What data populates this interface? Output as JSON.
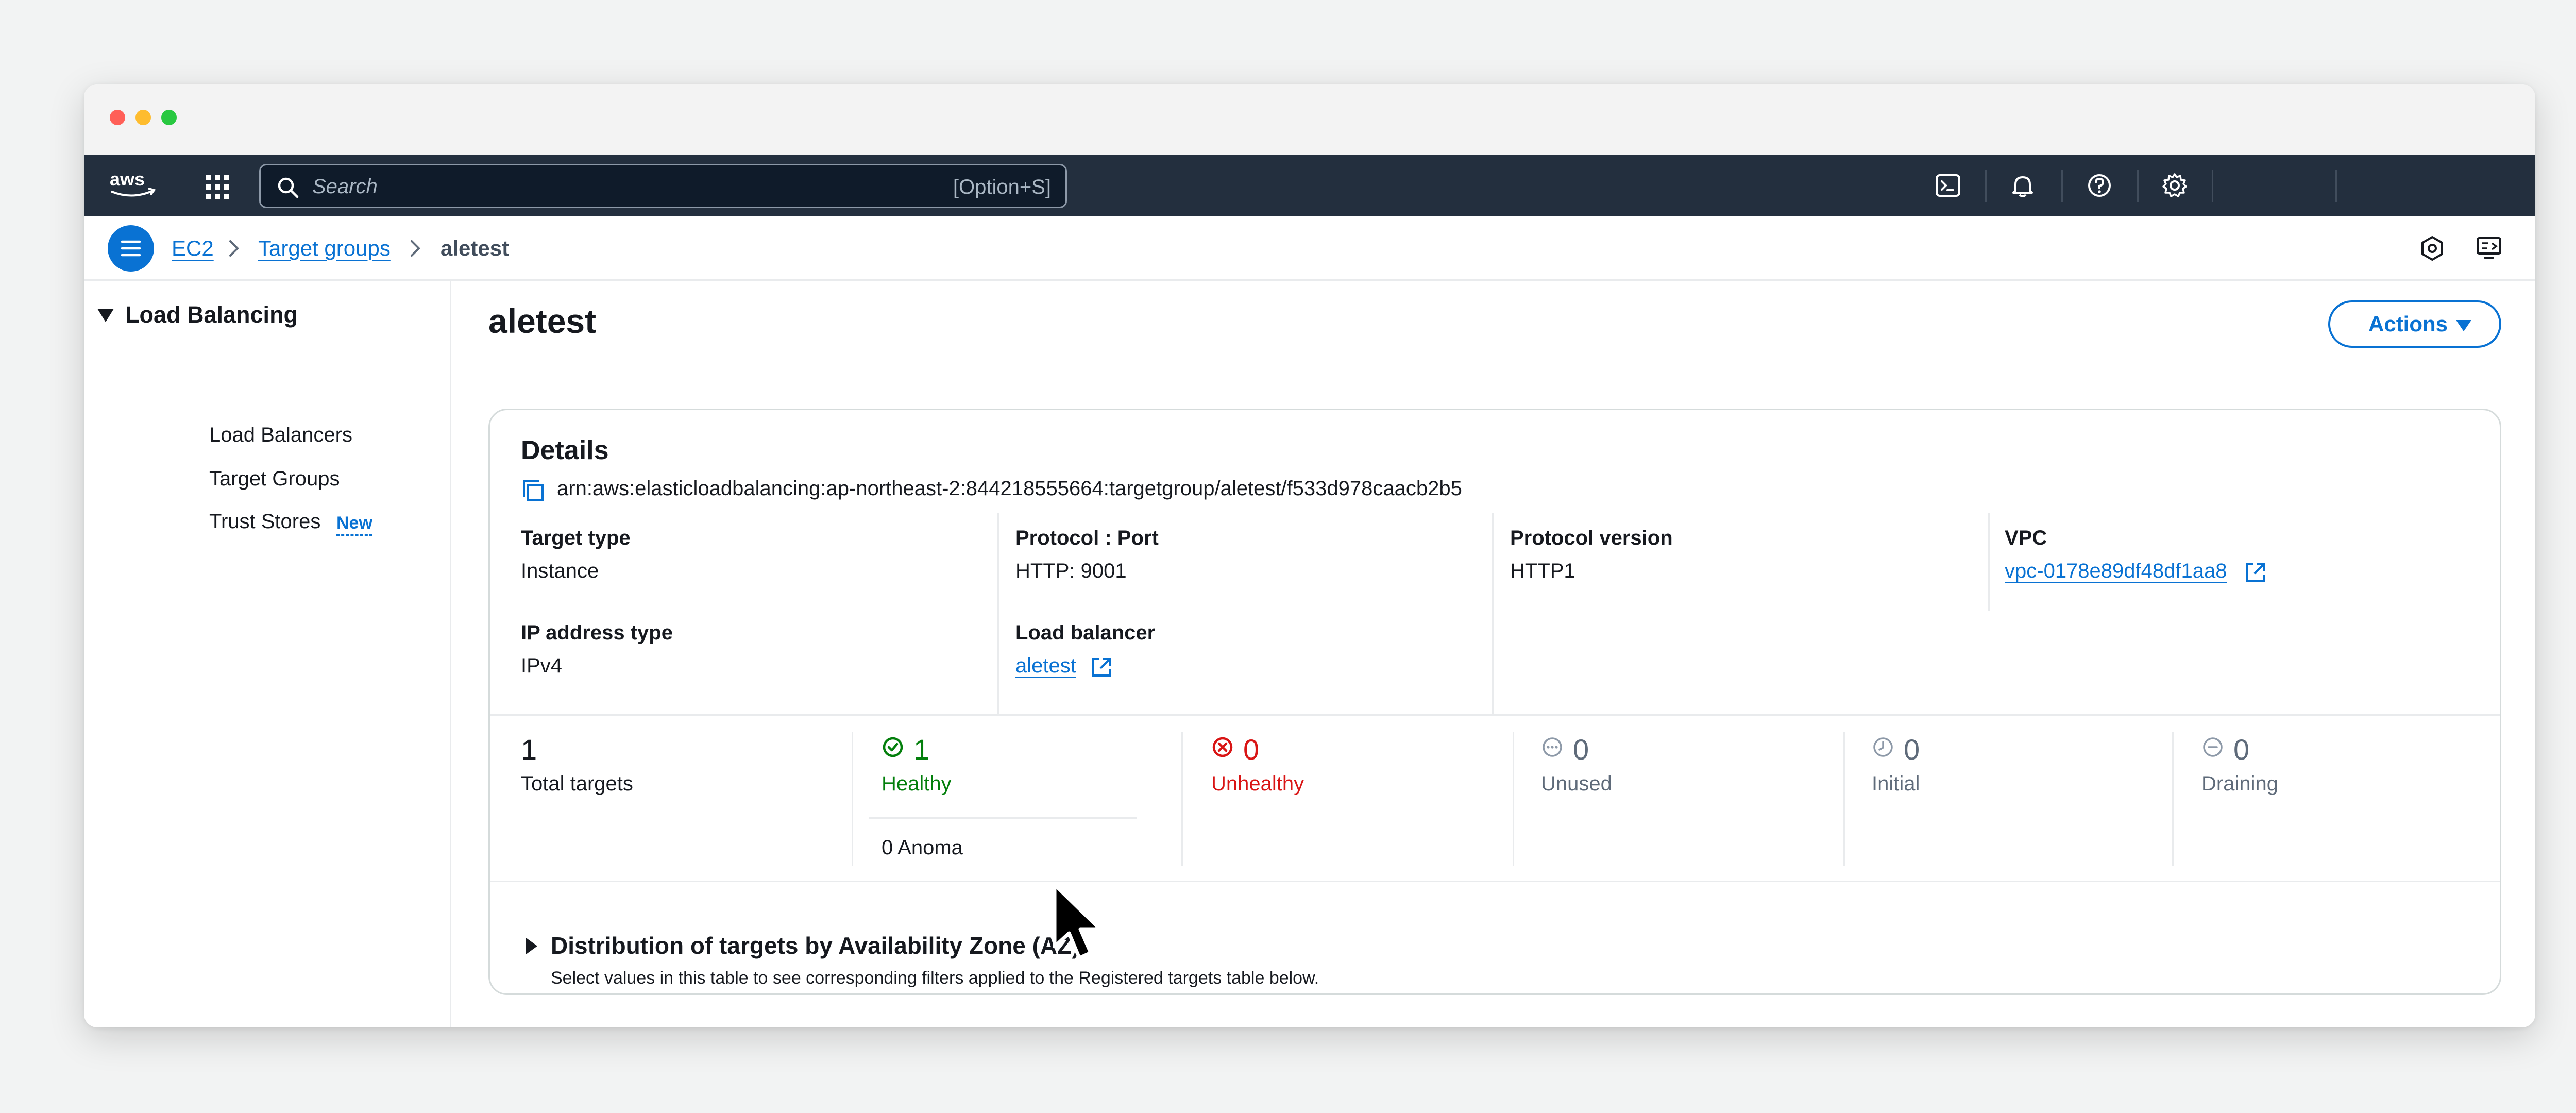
{
  "search": {
    "placeholder": "Search",
    "shortcut": "[Option+S]"
  },
  "breadcrumb": {
    "items": [
      "EC2",
      "Target groups"
    ],
    "current": "aletest"
  },
  "sidebar": {
    "section": "Load Balancing",
    "items": [
      {
        "label": "Load Balancers"
      },
      {
        "label": "Target Groups"
      },
      {
        "label": "Trust Stores",
        "badge": "New"
      }
    ]
  },
  "page": {
    "title": "aletest",
    "actions_label": "Actions"
  },
  "details": {
    "title": "Details",
    "arn": "arn:aws:elasticloadbalancing:ap-northeast-2:844218555664:targetgroup/aletest/f533d978caacb2b5",
    "fields": {
      "target_type": {
        "label": "Target type",
        "value": "Instance"
      },
      "protocol_port": {
        "label": "Protocol : Port",
        "value": "HTTP: 9001"
      },
      "protocol_version": {
        "label": "Protocol version",
        "value": "HTTP1"
      },
      "vpc": {
        "label": "VPC",
        "value": "vpc-0178e89df48df1aa8"
      },
      "ip_address_type": {
        "label": "IP address type",
        "value": "IPv4"
      },
      "load_balancer": {
        "label": "Load balancer",
        "value": "aletest"
      }
    }
  },
  "stats": {
    "total": {
      "value": "1",
      "label": "Total targets"
    },
    "healthy": {
      "value": "1",
      "label": "Healthy",
      "anomalous": "0 Anoma"
    },
    "unhealthy": {
      "value": "0",
      "label": "Unhealthy"
    },
    "unused": {
      "value": "0",
      "label": "Unused"
    },
    "initial": {
      "value": "0",
      "label": "Initial"
    },
    "draining": {
      "value": "0",
      "label": "Draining"
    }
  },
  "distribution": {
    "title": "Distribution of targets by Availability Zone (AZ)",
    "description": "Select values in this table to see corresponding filters applied to the Registered targets table below."
  },
  "colors": {
    "nav_bg": "#232f3e",
    "link": "#0972d3",
    "success": "#037f0c",
    "error": "#d91515",
    "muted": "#5f6b7a"
  },
  "icons": {
    "nav": [
      "cloudshell-icon",
      "bell-icon",
      "help-icon",
      "gear-icon"
    ],
    "breadcrumb_right": [
      "hexagon-settings-icon",
      "display-help-icon"
    ]
  }
}
